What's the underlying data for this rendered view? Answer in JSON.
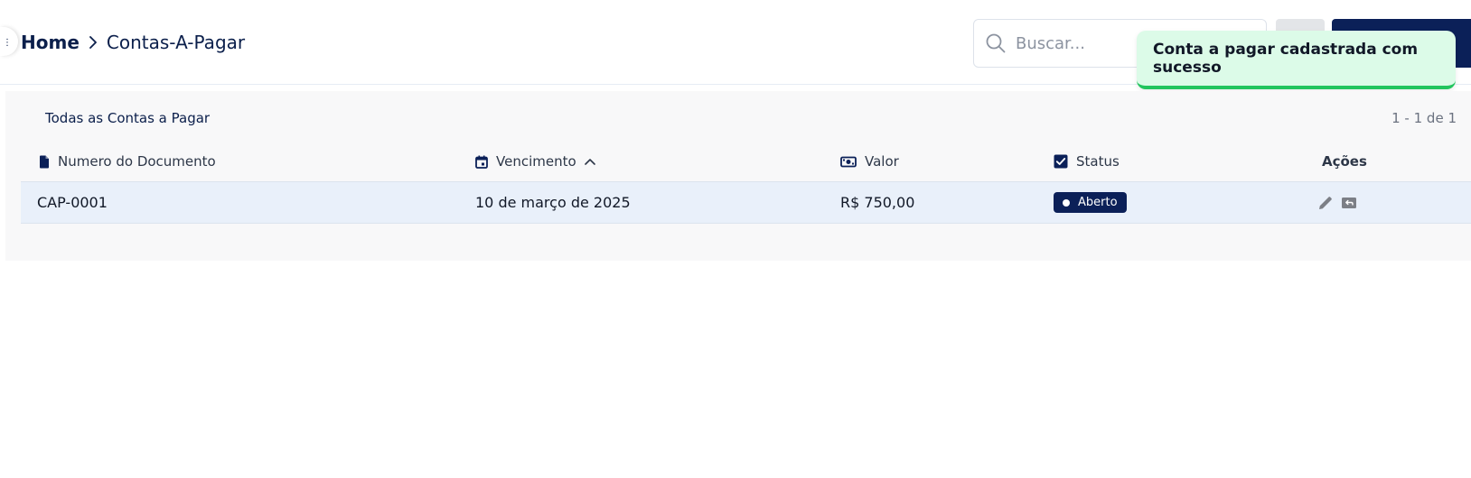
{
  "breadcrumb": {
    "home": "Home",
    "current": "Contas-A-Pagar"
  },
  "search": {
    "placeholder": "Buscar...",
    "value": ""
  },
  "toast": {
    "message": "Conta a pagar cadastrada com sucesso"
  },
  "card": {
    "title": "Todas as Contas a Pagar",
    "pagination": "1 - 1 de 1"
  },
  "table": {
    "headers": {
      "documento": "Numero do Documento",
      "vencimento": "Vencimento",
      "valor": "Valor",
      "status": "Status",
      "acoes": "Ações"
    },
    "rows": [
      {
        "documento": "CAP-0001",
        "vencimento": "10 de março de 2025",
        "valor": "R$ 750,00",
        "status": "Aberto"
      }
    ]
  },
  "icons": {
    "search": "search-icon",
    "breadcrumb_separator": "chevron-right-icon",
    "document": "file-icon",
    "calendar": "calendar-icon",
    "money": "money-icon",
    "status": "checkbox-icon",
    "sort": "chevron-up-icon",
    "edit": "pencil-icon",
    "return": "return-icon"
  },
  "colors": {
    "primary": "#0b2058",
    "toast_bg": "#dcfbe8",
    "toast_accent": "#22c55e",
    "row_highlight": "#e9f0fa"
  }
}
